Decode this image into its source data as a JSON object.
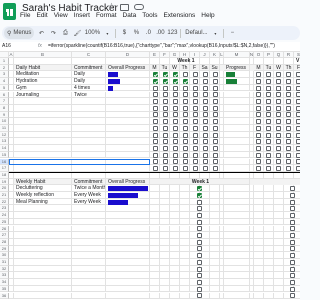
{
  "app": {
    "doc_title": "Sarah's Habit Tracker",
    "menus": [
      "File",
      "Edit",
      "View",
      "Insert",
      "Format",
      "Data",
      "Tools",
      "Extensions",
      "Help"
    ]
  },
  "toolbar": {
    "search_label": "Menus",
    "zoom": "100%",
    "currency": "$",
    "percent": "%",
    "decimals_down": ".0",
    "decimals_up": ".00",
    "number_format": "123",
    "font": "Defaul..."
  },
  "formula_bar": {
    "cell_ref": "A16",
    "fx": "fx",
    "formula": "=iferror(sparkline(countif(B16:B16,true),{\"charttype\",\"bar\";\"max\",vlookup(B16,Inputs!$L:$N,2,false)}),\"\")"
  },
  "columns": [
    "A",
    "B",
    "C",
    "D",
    "E",
    "F",
    "G",
    "H",
    "I",
    "J",
    "K",
    "L",
    "M",
    "N",
    "O",
    "P",
    "Q",
    "R",
    "S"
  ],
  "rows_top": [
    "1",
    "2",
    "3",
    "4",
    "5",
    "6",
    "7",
    "8",
    "9",
    "10",
    "11",
    "12",
    "13",
    "14",
    "15",
    "16",
    "17"
  ],
  "rows_bottom": [
    "18",
    "19",
    "20",
    "21",
    "22",
    "23",
    "24",
    "25",
    "26",
    "27",
    "28",
    "29",
    "30",
    "31",
    "32",
    "33",
    "34",
    "35",
    "36"
  ],
  "daily": {
    "week_label": "Week 1",
    "week_label_2": "V",
    "header_habit": "Daily Habit",
    "header_commitment": "Commitment",
    "header_progress": "Overall Progress",
    "days": [
      "M",
      "Tu",
      "W",
      "Th",
      "F",
      "Sa",
      "Su"
    ],
    "progress_header": "Progress",
    "days_2": [
      "M",
      "Tu",
      "W",
      "Th",
      "F",
      "Sa"
    ],
    "habits": [
      {
        "name": "Meditation",
        "commitment": "Daily",
        "overall": 0.5,
        "checks": [
          true,
          true,
          true,
          false,
          false,
          false,
          false
        ],
        "progress": 0.45
      },
      {
        "name": "Hydration",
        "commitment": "Daily",
        "overall": 0.6,
        "checks": [
          true,
          true,
          true,
          true,
          false,
          false,
          false
        ],
        "progress": 0.55
      },
      {
        "name": "Gym",
        "commitment": "4 times",
        "overall": 0.25,
        "checks": [
          false,
          false,
          false,
          false,
          false,
          false,
          false
        ],
        "progress": 0
      },
      {
        "name": "Journaling",
        "commitment": "Twice",
        "overall": 0,
        "checks": [
          false,
          false,
          false,
          false,
          false,
          false,
          false
        ],
        "progress": 0
      }
    ]
  },
  "weekly": {
    "header_habit": "Weekly Habit",
    "header_commitment": "Commitment",
    "header_progress": "Overall Progress",
    "week_label": "Week 1",
    "habits": [
      {
        "name": "Decluttering",
        "commitment": "Twice a Month",
        "overall": 1.0,
        "check": true
      },
      {
        "name": "Weekly reflection",
        "commitment": "Every Week",
        "overall": 0.75,
        "check": true
      },
      {
        "name": "Meal Planning",
        "commitment": "Every Week",
        "overall": 0.5,
        "check": false
      }
    ]
  },
  "colors": {
    "accent_blue": "#1a0dce",
    "progress_green": "#188038",
    "header_band": "#f3f3f3"
  }
}
